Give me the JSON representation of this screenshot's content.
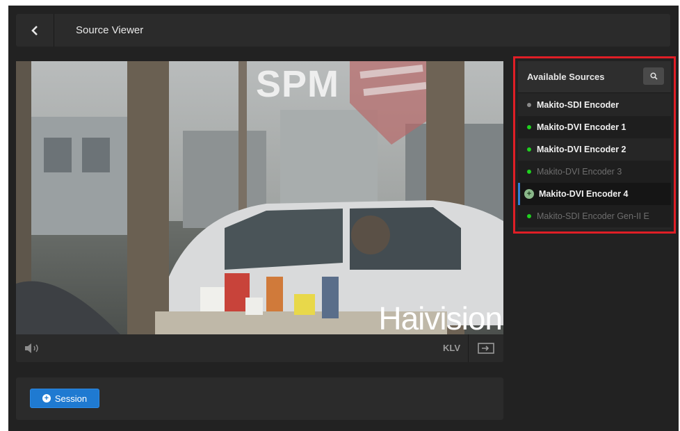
{
  "header": {
    "title": "Source Viewer"
  },
  "video": {
    "overlay_text": "SPM",
    "watermark": "Haivision",
    "controls": {
      "klv_label": "KLV"
    }
  },
  "session": {
    "button_label": "Session"
  },
  "sources": {
    "title": "Available Sources",
    "items": [
      {
        "label": "Makito-SDI Encoder",
        "status": "gray",
        "state": "normal"
      },
      {
        "label": "Makito-DVI Encoder 1",
        "status": "green",
        "state": "normal"
      },
      {
        "label": "Makito-DVI Encoder 2",
        "status": "green",
        "state": "normal"
      },
      {
        "label": "Makito-DVI Encoder 3",
        "status": "green",
        "state": "dim"
      },
      {
        "label": "Makito-DVI Encoder 4",
        "status": "green",
        "state": "selected"
      },
      {
        "label": "Makito-SDI Encoder Gen-II E",
        "status": "green",
        "state": "dim"
      }
    ]
  },
  "colors": {
    "accent": "#1f7ad1",
    "highlight_frame": "#e01e26",
    "status_green": "#1fd11f"
  }
}
